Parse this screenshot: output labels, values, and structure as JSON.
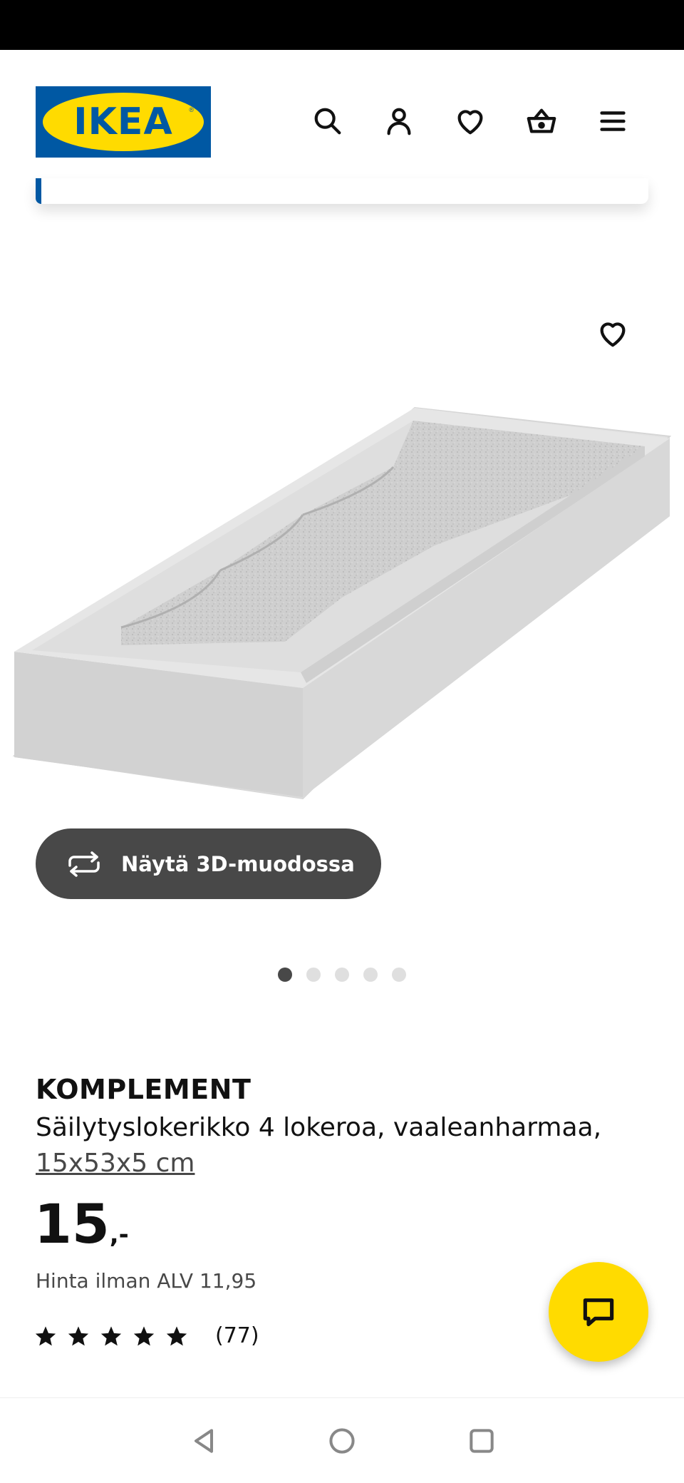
{
  "header": {
    "logo_text": "IKEA",
    "logo_mark": "®",
    "icons": [
      "search-icon",
      "user-icon",
      "heart-icon",
      "basket-icon",
      "menu-icon"
    ]
  },
  "gallery": {
    "view_3d_label": "Näytä 3D-muodossa",
    "pagination": {
      "total": 5,
      "active": 1
    }
  },
  "product": {
    "brand": "KOMPLEMENT",
    "description": "Säilytyslokerikko 4 lokeroa, vaaleanharmaa,",
    "size": "15x53x5 cm",
    "price_main": "15",
    "price_suffix": ",-",
    "vat_text": "Hinta ilman ALV 11,95",
    "rating": {
      "stars": 5,
      "count_text": "(77)"
    }
  },
  "colors": {
    "ikea_blue": "#0058a3",
    "ikea_yellow": "#ffdb00",
    "button_dark": "#484848"
  }
}
